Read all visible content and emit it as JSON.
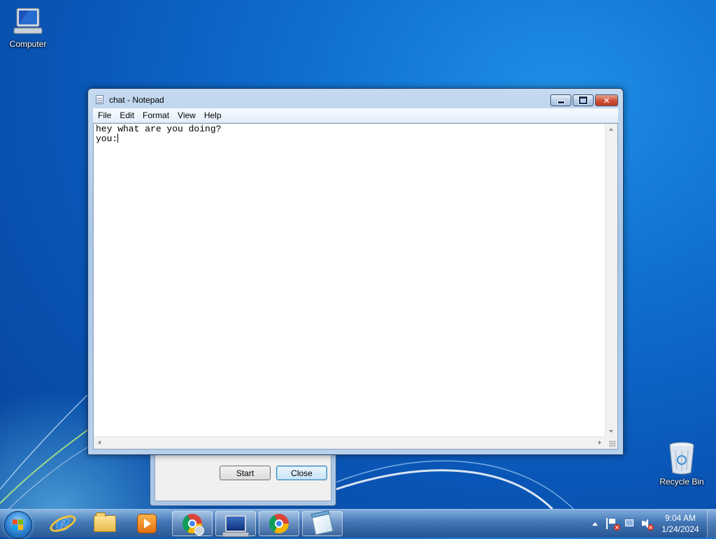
{
  "desktop": {
    "icons": [
      {
        "label": "Computer",
        "icon": "computer-icon"
      },
      {
        "label": "Recycle Bin",
        "icon": "recycle-bin-icon"
      }
    ]
  },
  "background_dialog": {
    "start_label": "Start",
    "close_label": "Close"
  },
  "notepad": {
    "title": "chat - Notepad",
    "menu": [
      "File",
      "Edit",
      "Format",
      "View",
      "Help"
    ],
    "lines": [
      "hey what are you doing?",
      "you:"
    ],
    "caption_buttons": [
      "minimize",
      "maximize",
      "close"
    ]
  },
  "taskbar": {
    "pinned": [
      {
        "name": "start-orb",
        "icon": "windows-logo-icon"
      },
      {
        "name": "internet-explorer",
        "icon": "ie-icon"
      },
      {
        "name": "windows-explorer",
        "icon": "folder-icon"
      },
      {
        "name": "windows-media-player",
        "icon": "media-player-icon"
      },
      {
        "name": "chrome-profile",
        "icon": "chrome-icon",
        "running": true
      },
      {
        "name": "remote-desktop",
        "icon": "computer-icon",
        "running": true
      },
      {
        "name": "chrome",
        "icon": "chrome-icon",
        "running": true
      },
      {
        "name": "notepad",
        "icon": "notepad-icon",
        "running": true
      }
    ],
    "tray": {
      "icons": [
        "show-hidden-icons",
        "action-center-flag-icon",
        "network-icon",
        "speaker-muted-icon"
      ],
      "time": "9:04 AM",
      "date": "1/24/2024"
    }
  },
  "colors": {
    "desktop_blue": "#0a56b6",
    "window_frame": "#a9c6e6",
    "close_button": "#d2543a"
  }
}
